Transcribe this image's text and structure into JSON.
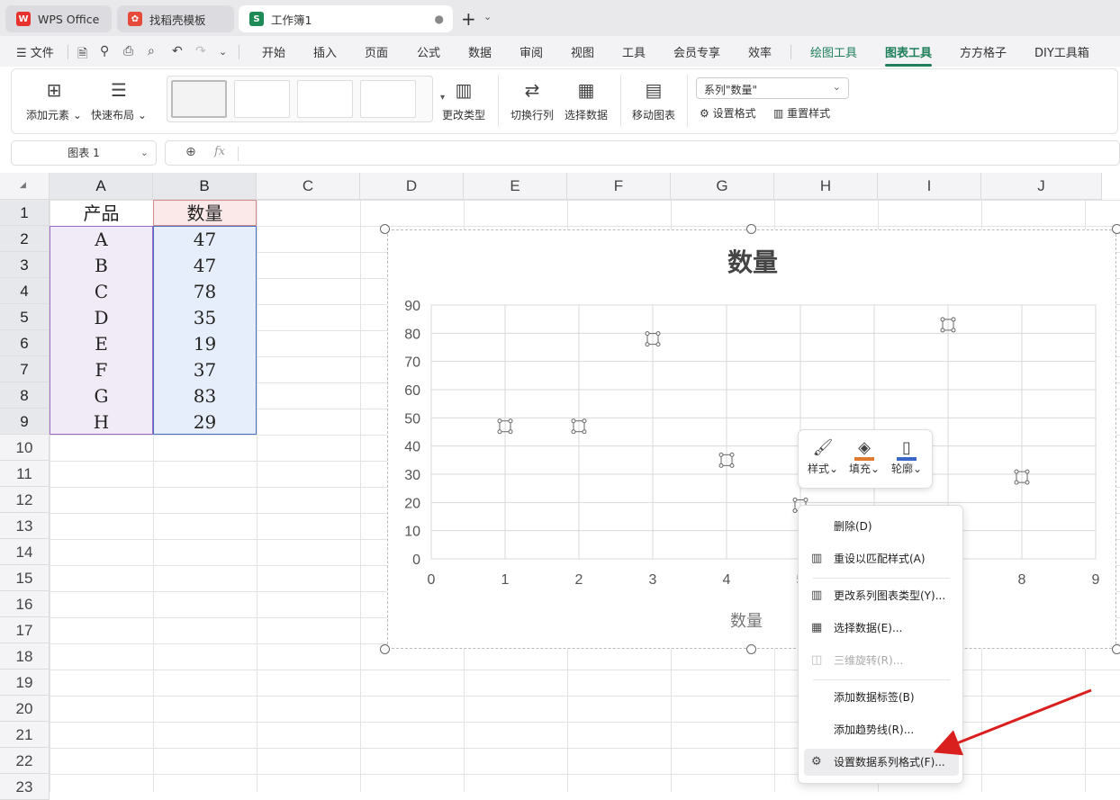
{
  "tabs": [
    {
      "label": "WPS Office",
      "icon": "wps-logo-icon"
    },
    {
      "label": "找稻壳模板",
      "icon": "daoke-icon"
    },
    {
      "label": "工作簿1",
      "icon": "sheet-s-icon"
    }
  ],
  "menu": {
    "file": "文件",
    "items": [
      "开始",
      "插入",
      "页面",
      "公式",
      "数据",
      "审阅",
      "视图",
      "工具",
      "会员专享",
      "效率",
      "绘图工具",
      "图表工具",
      "方方格子",
      "DIY工具箱"
    ],
    "active": "图表工具"
  },
  "ribbon": {
    "add_element": "添加元素",
    "quick_layout": "快速布局",
    "change_type": "更改类型",
    "switch_row_col": "切换行列",
    "select_data": "选择数据",
    "move_chart": "移动图表",
    "series_select": "系列\"数量\"",
    "set_format": "设置格式",
    "reset_style": "重置样式"
  },
  "formula_bar": {
    "name_box": "图表 1",
    "fx": "fx"
  },
  "columns": [
    "A",
    "B",
    "C",
    "D",
    "E",
    "F",
    "G",
    "H",
    "I",
    "J"
  ],
  "rows": [
    "1",
    "2",
    "3",
    "4",
    "5",
    "6",
    "7",
    "8",
    "9",
    "10",
    "11",
    "12",
    "13",
    "14",
    "15",
    "16",
    "17",
    "18",
    "19",
    "20",
    "21",
    "22",
    "23"
  ],
  "table": {
    "headers": [
      "产品",
      "数量"
    ],
    "rows": [
      [
        "A",
        "47"
      ],
      [
        "B",
        "47"
      ],
      [
        "C",
        "78"
      ],
      [
        "D",
        "35"
      ],
      [
        "E",
        "19"
      ],
      [
        "F",
        "37"
      ],
      [
        "G",
        "83"
      ],
      [
        "H",
        "29"
      ]
    ]
  },
  "chart_data": {
    "type": "scatter",
    "title": "数量",
    "xlabel": "数量",
    "ylabel": "",
    "x": [
      1,
      2,
      3,
      4,
      5,
      6,
      7,
      8
    ],
    "y": [
      47,
      47,
      78,
      35,
      19,
      37,
      83,
      29
    ],
    "xlim": [
      0,
      9
    ],
    "ylim": [
      0,
      90
    ],
    "xticks": [
      "0",
      "1",
      "2",
      "3",
      "4",
      "5",
      "6",
      "7",
      "8",
      "9"
    ],
    "yticks": [
      "0",
      "10",
      "20",
      "30",
      "40",
      "50",
      "60",
      "70",
      "80",
      "90"
    ],
    "grid": true,
    "marker_color": "#666666"
  },
  "float_toolbar": {
    "style": "样式",
    "fill": "填充",
    "outline": "轮廓",
    "fill_color": "#e07a2e",
    "outline_color": "#3a68c9"
  },
  "context_menu": {
    "items": [
      {
        "label": "删除(D)",
        "icon": "",
        "disabled": false
      },
      {
        "label": "重设以匹配样式(A)",
        "icon": "reset-style-icon",
        "disabled": false
      },
      {
        "label": "更改系列图表类型(Y)...",
        "icon": "chart-type-icon",
        "disabled": false
      },
      {
        "label": "选择数据(E)...",
        "icon": "select-data-icon",
        "disabled": false
      },
      {
        "label": "三维旋转(R)...",
        "icon": "3d-rotate-icon",
        "disabled": true
      },
      {
        "label": "添加数据标签(B)",
        "icon": "",
        "disabled": false
      },
      {
        "label": "添加趋势线(R)...",
        "icon": "",
        "disabled": false
      },
      {
        "label": "设置数据系列格式(F)...",
        "icon": "format-series-icon",
        "disabled": false
      }
    ]
  },
  "colors": {
    "accent": "#1e7f5a",
    "arrow": "#d9201e"
  }
}
